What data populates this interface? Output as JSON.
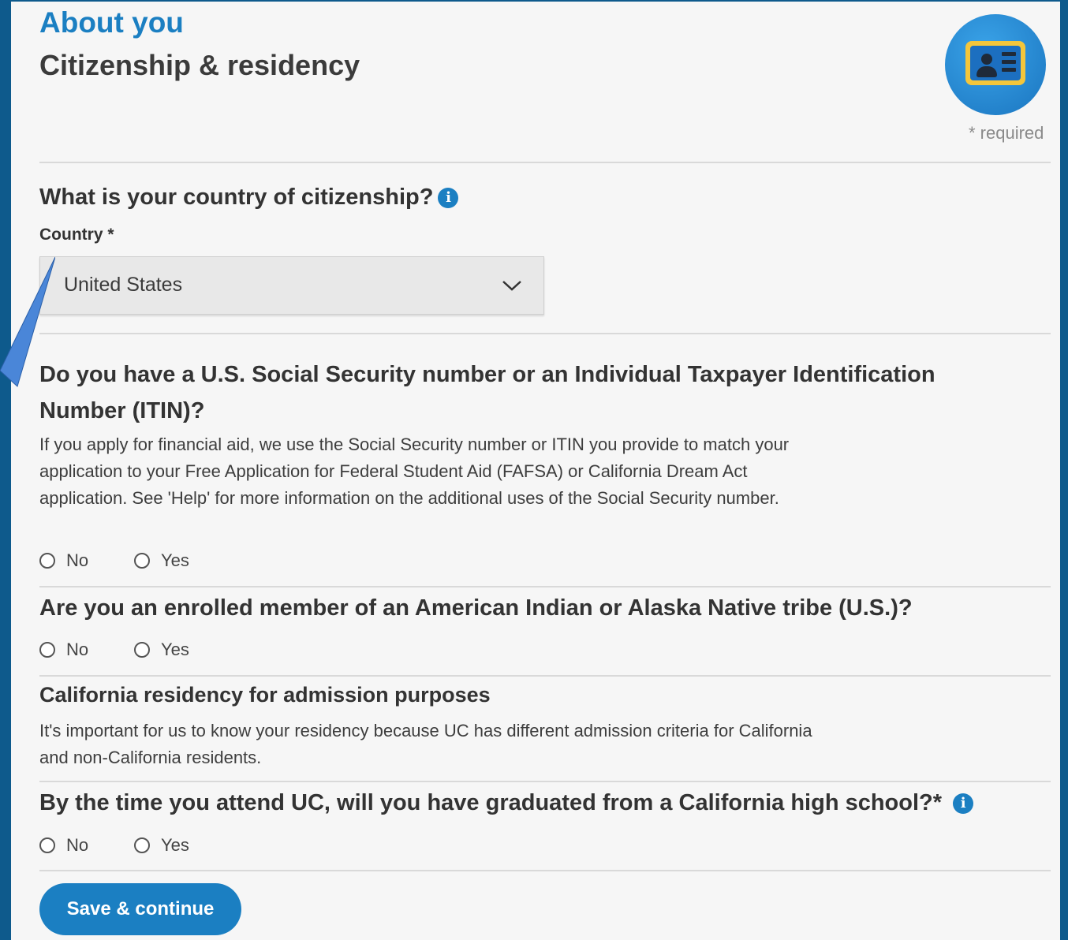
{
  "header": {
    "section": "About you",
    "title": "Citizenship & residency",
    "required_note": "* required"
  },
  "citizenship": {
    "question": "What is your country of citizenship?",
    "country_label": "Country *",
    "country_value": "United States"
  },
  "ssn": {
    "question": "Do you have a U.S. Social Security number or an Individual Taxpayer Identification Number (ITIN)?",
    "help": "If you apply for financial aid, we use the Social Security number or ITIN you provide to match your application to your Free Application for Federal Student Aid (FAFSA) or California Dream Act application. See 'Help' for more information on the additional uses of the Social Security number.",
    "no": "No",
    "yes": "Yes"
  },
  "tribe": {
    "question": "Are you an enrolled member of an American Indian or Alaska Native tribe (U.S.)?",
    "no": "No",
    "yes": "Yes"
  },
  "residency": {
    "heading": "California residency for admission purposes",
    "help": "It's important for us to know your residency because UC has different admission criteria for California and non-California residents."
  },
  "graduation": {
    "question": "By the time you attend UC, will you have graduated from a California high school?*",
    "no": "No",
    "yes": "Yes"
  },
  "actions": {
    "save_label": "Save & continue"
  },
  "colors": {
    "background": "#0e5a8c",
    "panel": "#f6f6f6",
    "accent": "#1b7fc2",
    "pointer": "#4a86d8"
  }
}
